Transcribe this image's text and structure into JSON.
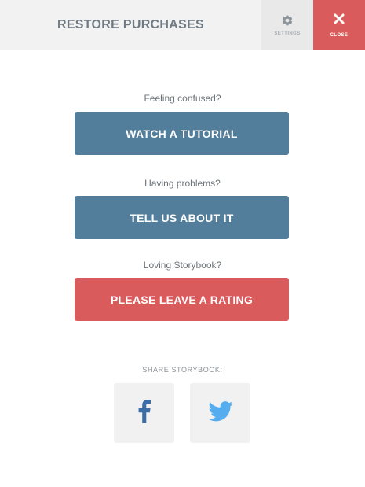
{
  "header": {
    "restore_label": "RESTORE PURCHASES",
    "settings_label": "SETTINGS",
    "close_label": "CLOSE"
  },
  "sections": [
    {
      "prompt": "Feeling confused?",
      "button": "WATCH A TUTORIAL"
    },
    {
      "prompt": "Having problems?",
      "button": "TELL US ABOUT IT"
    },
    {
      "prompt": "Loving Storybook?",
      "button": "PLEASE LEAVE A RATING"
    }
  ],
  "share": {
    "label": "SHARE STORYBOOK:",
    "icons": [
      "facebook-icon",
      "twitter-icon"
    ]
  },
  "colors": {
    "primary_button": "#527d9b",
    "rating_button": "#da5b5b",
    "close_background": "#da5b5b",
    "facebook": "#3b6ea5",
    "twitter": "#55acee"
  }
}
